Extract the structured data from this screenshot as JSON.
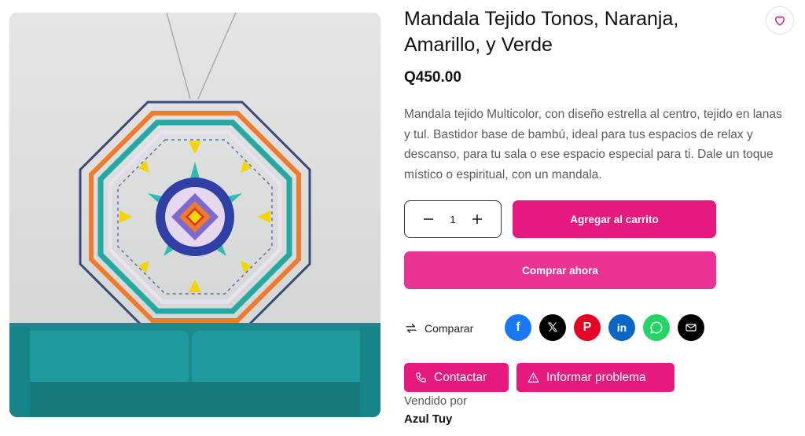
{
  "product": {
    "title": "Mandala Tejido Tonos, Naranja, Amarillo, y Verde",
    "price": "Q450.00",
    "description": "Mandala tejido Multicolor, con diseño estrella al centro, tejido en lanas y tul. Bastidor base de bambú, ideal para tus espacios de relax y descanso, para tu sala o ese espacio especial para ti. Dale un toque místico o espiritual, con un mandala.",
    "image_icon": "mandala-photo"
  },
  "quantity": {
    "value": "1",
    "minus_icon": "minus-icon",
    "plus_icon": "plus-icon"
  },
  "actions": {
    "add_to_cart": "Agregar al carrito",
    "buy_now": "Comprar ahora",
    "compare": "Comparar",
    "contact": "Contactar",
    "report": "Informar problema"
  },
  "social": [
    {
      "name": "facebook",
      "color": "#1877f2"
    },
    {
      "name": "x",
      "color": "#000000"
    },
    {
      "name": "pinterest",
      "color": "#e60023"
    },
    {
      "name": "linkedin",
      "color": "#0a66c2"
    },
    {
      "name": "whatsapp",
      "color": "#25d366"
    },
    {
      "name": "email",
      "color": "#000000"
    }
  ],
  "seller": {
    "label": "Vendido por",
    "name": "Azul Tuy"
  },
  "colors": {
    "accent": "#e6197f",
    "accent_light": "#ea3392"
  }
}
